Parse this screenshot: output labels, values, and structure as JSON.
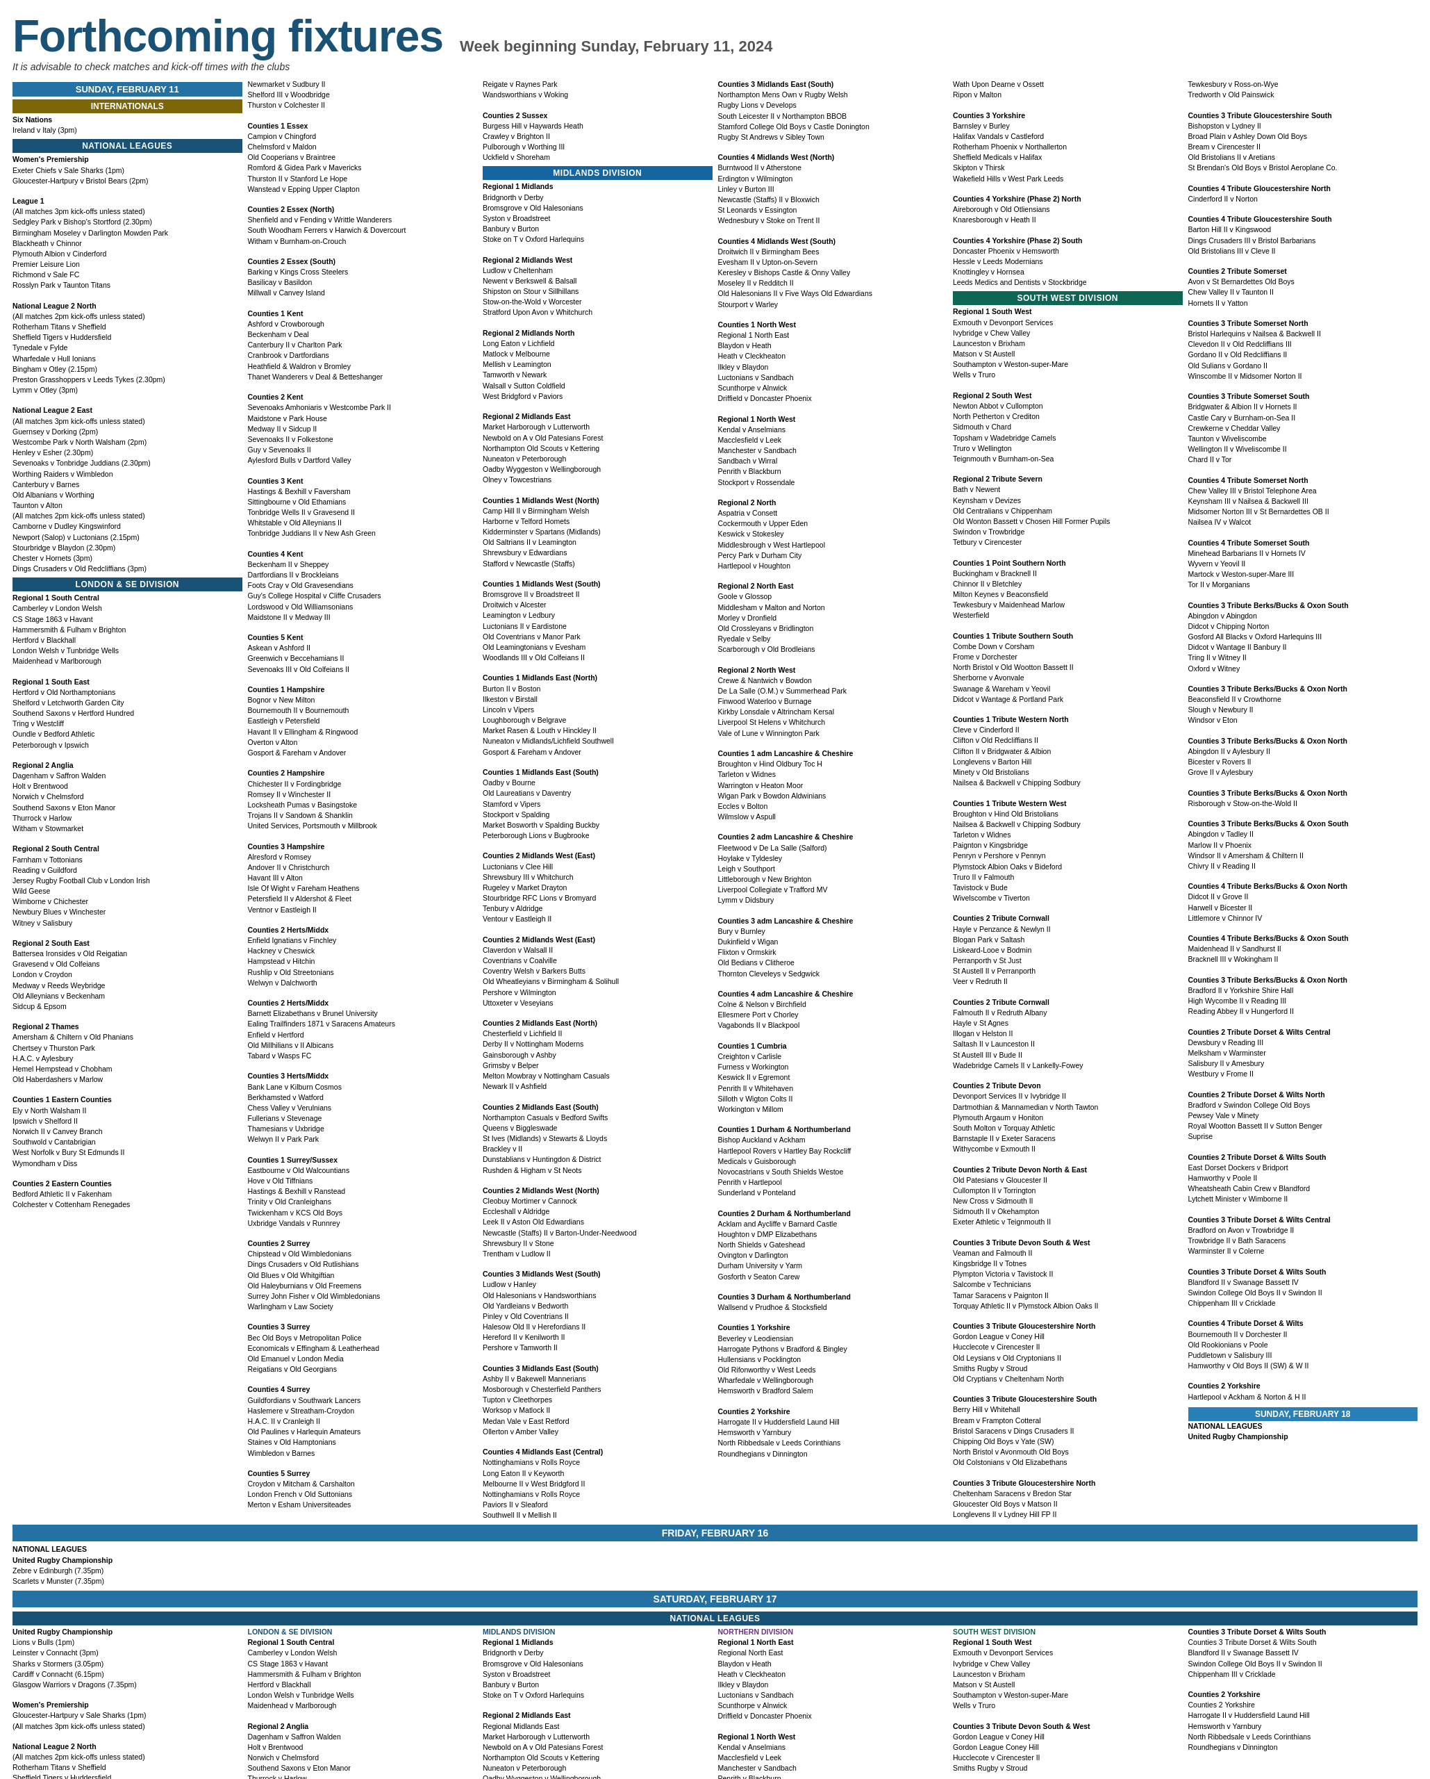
{
  "header": {
    "title": "Forthcoming fixtures",
    "week": "Week beginning Sunday, February 11, 2024",
    "note": "It is advisable to check matches and kick-off times with the clubs"
  },
  "sunday_feb11": {
    "label": "SUNDAY, FEBRUARY 11",
    "internationals": {
      "label": "INTERNATIONALS",
      "matches": [
        "Six Nations",
        "Ireland v Italy (3pm)"
      ]
    },
    "national_leagues": {
      "label": "NATIONAL LEAGUES",
      "womens_prem": {
        "label": "Women's Premiership",
        "matches": [
          "Exeter Chiefs v Sale Sharks (1pm)",
          "Gloucester-Hartpury v Bristol Bears (2pm)"
        ]
      },
      "league1": {
        "label": "League 1",
        "note": "(All matches 3pm kick-offs unless stated)",
        "matches": [
          "Sedgley Park v Bishop's Stortford (2.30pm)",
          "Birmingham Moseley v Darlington Mowden Park"
        ]
      }
    }
  },
  "sections": {
    "sunday_header": "SUNDAY, FEBRUARY 11",
    "national_leagues_header": "NATIONAL LEAGUES",
    "friday_header": "FRIDAY, FEBRUARY 16",
    "saturday_header": "SATURDAY, FEBRUARY 17"
  },
  "columns": [
    {
      "id": "col1",
      "blocks": []
    }
  ]
}
